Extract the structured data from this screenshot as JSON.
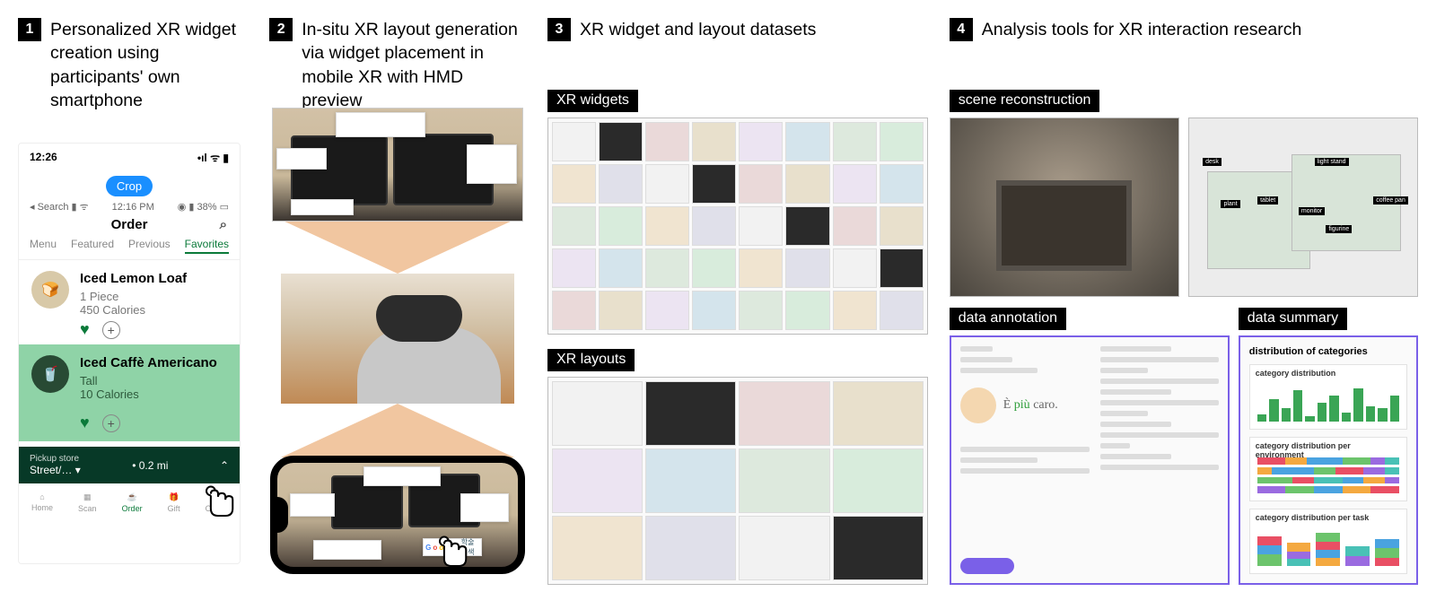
{
  "panels": {
    "p1": {
      "num": "1",
      "title": "Personalized XR widget creation using participants' own smartphone"
    },
    "p2": {
      "num": "2",
      "title": "In-situ XR layout generation via widget placement in mobile XR with HMD preview"
    },
    "p3": {
      "num": "3",
      "title": "XR widget and layout datasets"
    },
    "p4": {
      "num": "4",
      "title": "Analysis tools for XR interaction research"
    }
  },
  "subtitles": {
    "widgets": "XR widgets",
    "layouts": "XR layouts",
    "scene": "scene reconstruction",
    "annotation": "data annotation",
    "summary": "data summary"
  },
  "phone": {
    "time": "12:26",
    "crop": "Crop",
    "innerLeft": "◂ Search ▮ ᯤ",
    "innerTime": "12:16 PM",
    "innerRight": "◉ ▮ 38% ▭",
    "orderTitle": "Order",
    "tabs": {
      "menu": "Menu",
      "featured": "Featured",
      "previous": "Previous",
      "favorites": "Favorites"
    },
    "item1": {
      "name": "Iced Lemon Loaf",
      "line1": "1 Piece",
      "line2": "450 Calories"
    },
    "item2": {
      "name": "Iced Caffè Americano",
      "line1": "Tall",
      "line2": "10 Calories"
    },
    "pickup": {
      "label": "Pickup store",
      "store": "Street/…",
      "dist": "• 0.2 mi"
    },
    "tabbar": {
      "home": "Home",
      "scan": "Scan",
      "order": "Order",
      "gift": "Gift",
      "offers": "Offers"
    }
  },
  "annotation": {
    "phrase": "È più caro."
  },
  "summary": {
    "title": "distribution of categories",
    "chart1": "category distribution",
    "chart2": "category distribution per environment",
    "chart3": "category distribution per task"
  },
  "scene": {
    "tags": [
      "desk",
      "plant",
      "tablet",
      "light stand",
      "monitor",
      "figurine",
      "coffee pan"
    ]
  }
}
